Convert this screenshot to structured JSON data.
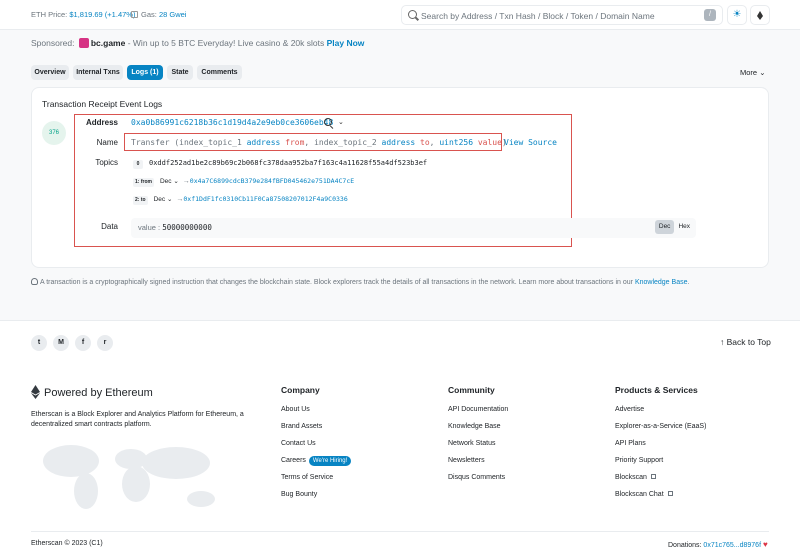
{
  "header": {
    "eth_price_label": "ETH Price:",
    "eth_price_value": "$1,819.69 (+1.47%)",
    "gas_label": "Gas:",
    "gas_value": "28 Gwei",
    "search_placeholder": "Search by Address / Txn Hash / Block / Token / Domain Name",
    "slash_key": "/",
    "theme_icon": "☀"
  },
  "sponsored": {
    "label": "Sponsored:",
    "brand": "bc.game",
    "text": " - Win up to 5 BTC Everyday! Live casino & 20k slots ",
    "cta": "Play Now"
  },
  "tabs": [
    {
      "label": "Overview",
      "active": false
    },
    {
      "label": "Internal Txns",
      "active": false
    },
    {
      "label": "Logs (1)",
      "active": true
    },
    {
      "label": "State",
      "active": false
    },
    {
      "label": "Comments",
      "active": false
    }
  ],
  "more_label": "More",
  "log": {
    "title": "Transaction Receipt Event Logs",
    "index": "376",
    "address_label": "Address",
    "address": "0xa0b86991c6218b36c1d19d4a2e9eb0ce3606eb48",
    "name_label": "Name",
    "sig": {
      "event": "Transfer (",
      "p1_name": "index_topic_1 ",
      "p1_type": "address",
      "p1_var": " from",
      "sep1": ", ",
      "p2_name": "index_topic_2 ",
      "p2_type": "address",
      "p2_var": " to",
      "sep2": ", ",
      "p3_type": "uint256",
      "p3_var": " value",
      "close": ")"
    },
    "view_source": "View Source",
    "topics_label": "Topics",
    "topics": [
      {
        "idx": "0",
        "hash": "0xddf252ad1be2c89b69c2b068fc378daa952ba7f163c4a11628f55a4df523b3ef"
      },
      {
        "idx": "1: from",
        "format": "Dec",
        "value": "0x4a7C6899cdcB379e284fBFD045462e751DA4C7cE"
      },
      {
        "idx": "2: to",
        "format": "Dec",
        "value": "0xf1DdF1fc0310Cb11F0Ca87508207012F4a9C0336"
      }
    ],
    "data_label": "Data",
    "data_key": "value : ",
    "data_value": "50000000000",
    "dec": "Dec",
    "hex": "Hex"
  },
  "info_note": {
    "text": "A transaction is a cryptographically signed instruction that changes the blockchain state. Block explorers track the details of all transactions in the network. Learn more about transactions in our ",
    "link": "Knowledge Base",
    "end": "."
  },
  "footer": {
    "back_to_top": "Back to Top",
    "powered": "Powered by Ethereum",
    "about": "Etherscan is a Block Explorer and Analytics Platform for Ethereum, a decentralized smart contracts platform.",
    "company_head": "Company",
    "company": [
      "About Us",
      "Brand Assets",
      "Contact Us",
      "Careers",
      "Terms of Service",
      "Bug Bounty"
    ],
    "hiring_badge": "We're Hiring!",
    "community_head": "Community",
    "community": [
      "API Documentation",
      "Knowledge Base",
      "Network Status",
      "Newsletters",
      "Disqus Comments"
    ],
    "products_head": "Products & Services",
    "products": [
      "Advertise",
      "Explorer-as-a-Service (EaaS)",
      "API Plans",
      "Priority Support",
      "Blockscan",
      "Blockscan Chat"
    ],
    "copyright": "Etherscan © 2023 (C1)",
    "donations_label": "Donations: ",
    "donations_addr": "0x71c765...d8976f"
  },
  "colors": {
    "accent": "#0784c3",
    "highlight": "#d9534f"
  }
}
